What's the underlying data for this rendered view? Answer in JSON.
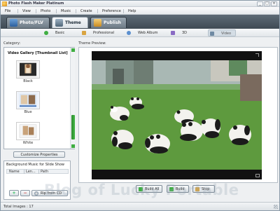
{
  "app": {
    "title": "Photo Flash Maker Platinum"
  },
  "window_controls": {
    "minimize": "_",
    "maximize": "□",
    "close": "×"
  },
  "menu": [
    "File",
    "View",
    "Photo",
    "Music",
    "Create",
    "Preference",
    "Help"
  ],
  "main_tabs": [
    {
      "label": "Photo/FLV",
      "icon": "photo-icon",
      "active": false
    },
    {
      "label": "Theme",
      "icon": "theme-icon",
      "active": true
    },
    {
      "label": "Publish",
      "icon": "publish-icon",
      "active": false
    }
  ],
  "sub_tabs": [
    {
      "label": "Basic",
      "icon": "basic-icon"
    },
    {
      "label": "Professional",
      "icon": "professional-icon"
    },
    {
      "label": "Web Album",
      "icon": "web-album-icon"
    },
    {
      "label": "3D",
      "icon": "3d-icon"
    },
    {
      "label": "Video",
      "icon": "video-icon",
      "active": true
    }
  ],
  "category": {
    "label": "Category:",
    "gallery_header": "Video Gallery [Thumbnail List]",
    "items": [
      {
        "label": "Black"
      },
      {
        "label": "Blue"
      },
      {
        "label": "White"
      }
    ]
  },
  "customize_button": "Customize Properties",
  "background_music": {
    "title": "Background Music for Slide Show",
    "columns": [
      "Name",
      "Len...",
      "Path"
    ],
    "add_button": "+",
    "remove_button": "−",
    "rip_button": "Rip from CD"
  },
  "preview": {
    "label": "Theme Preview:"
  },
  "actions": {
    "build_all": "Build All",
    "build": "Build",
    "stop": "Stop"
  },
  "status": {
    "total_images": "Total Images : 17"
  },
  "watermark": "Blog of Lucky Portable",
  "colors": {
    "accent_green": "#3fae42",
    "tab_bar": "#4b5661",
    "preview_bg": "#111111"
  }
}
